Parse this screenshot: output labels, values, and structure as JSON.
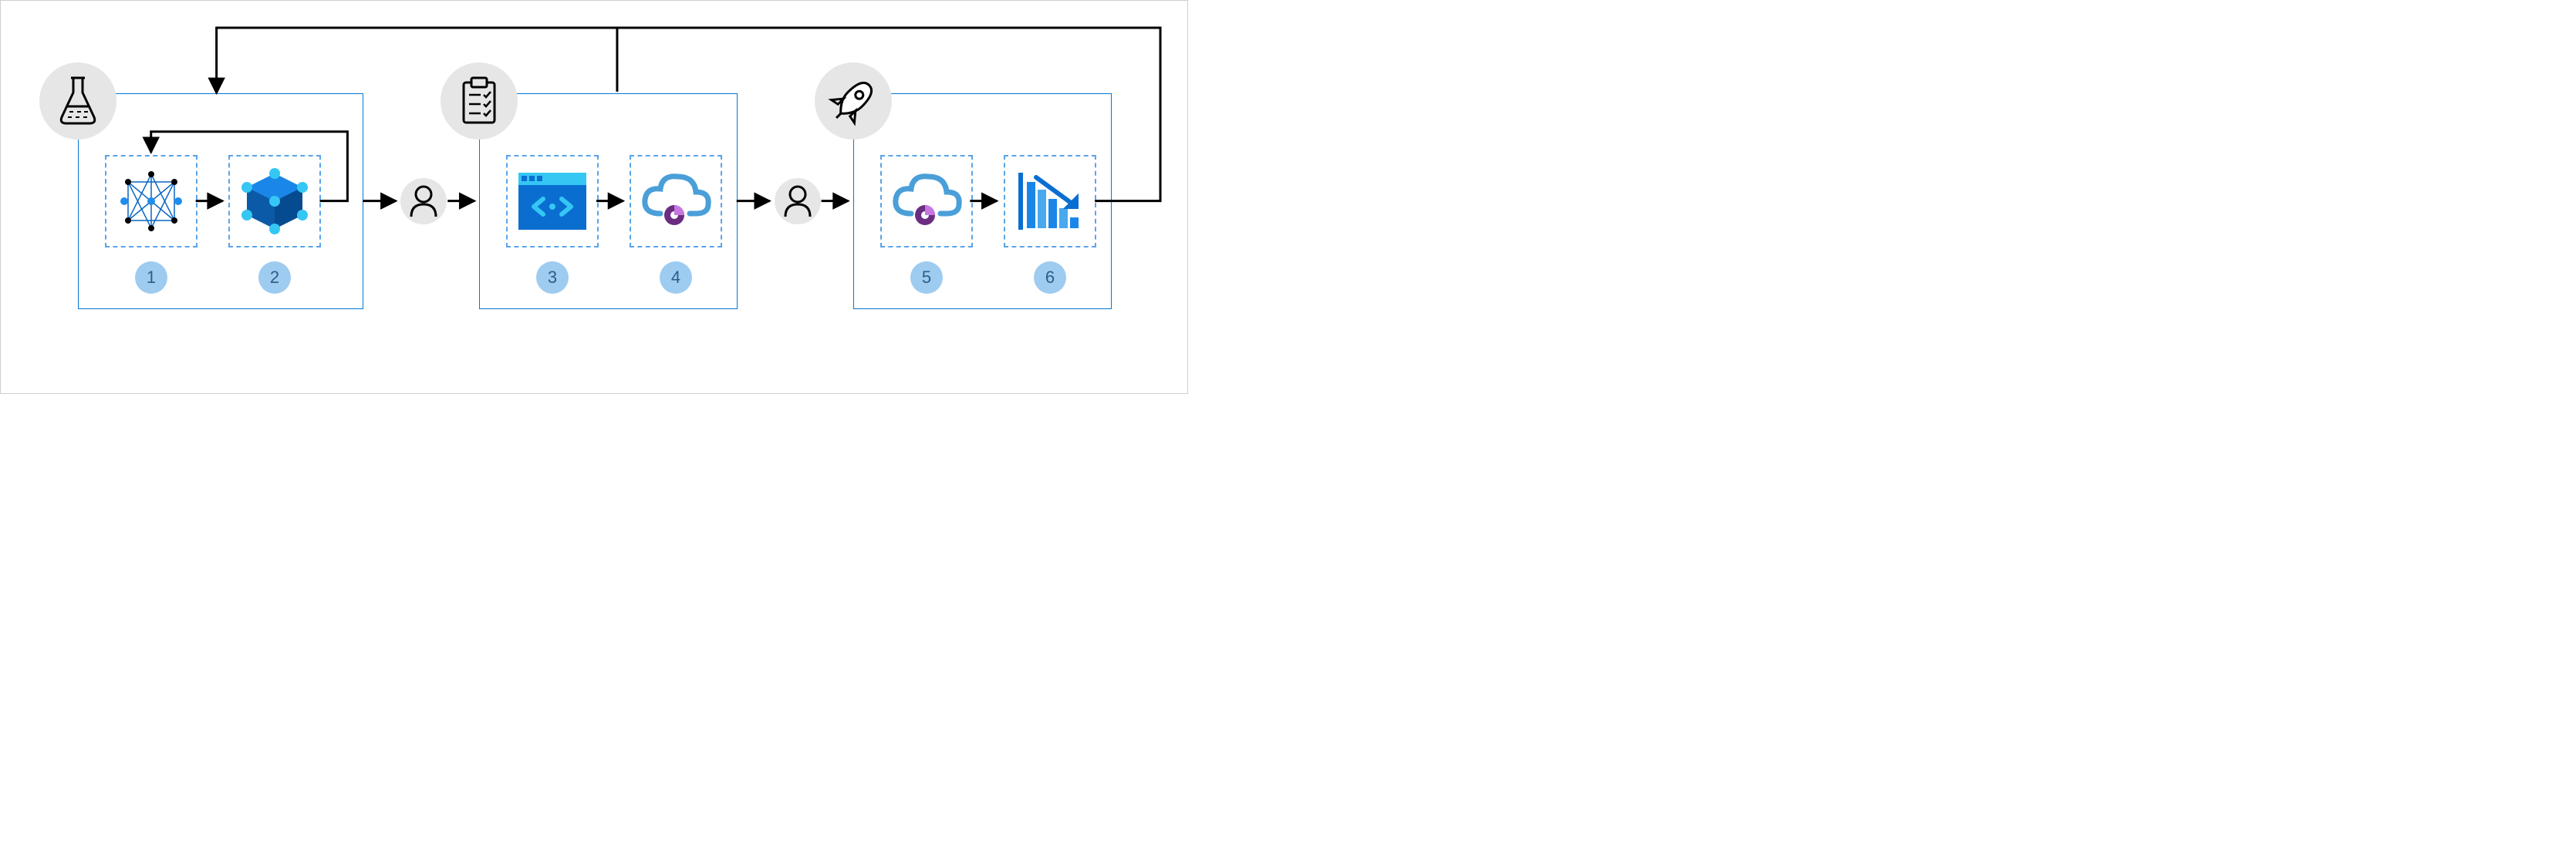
{
  "diagram": {
    "stages": [
      {
        "id": "experiment",
        "badge_icon": "flask-icon"
      },
      {
        "id": "validate",
        "badge_icon": "clipboard-icon"
      },
      {
        "id": "deploy",
        "badge_icon": "rocket-icon"
      }
    ],
    "steps": [
      {
        "num": "1",
        "icon": "neural-network-icon"
      },
      {
        "num": "2",
        "icon": "cube-icon"
      },
      {
        "num": "3",
        "icon": "code-window-icon"
      },
      {
        "num": "4",
        "icon": "cloud-insight-icon"
      },
      {
        "num": "5",
        "icon": "cloud-insight-icon"
      },
      {
        "num": "6",
        "icon": "declining-chart-icon"
      }
    ],
    "connectors": [
      "person-icon",
      "person-icon"
    ]
  }
}
